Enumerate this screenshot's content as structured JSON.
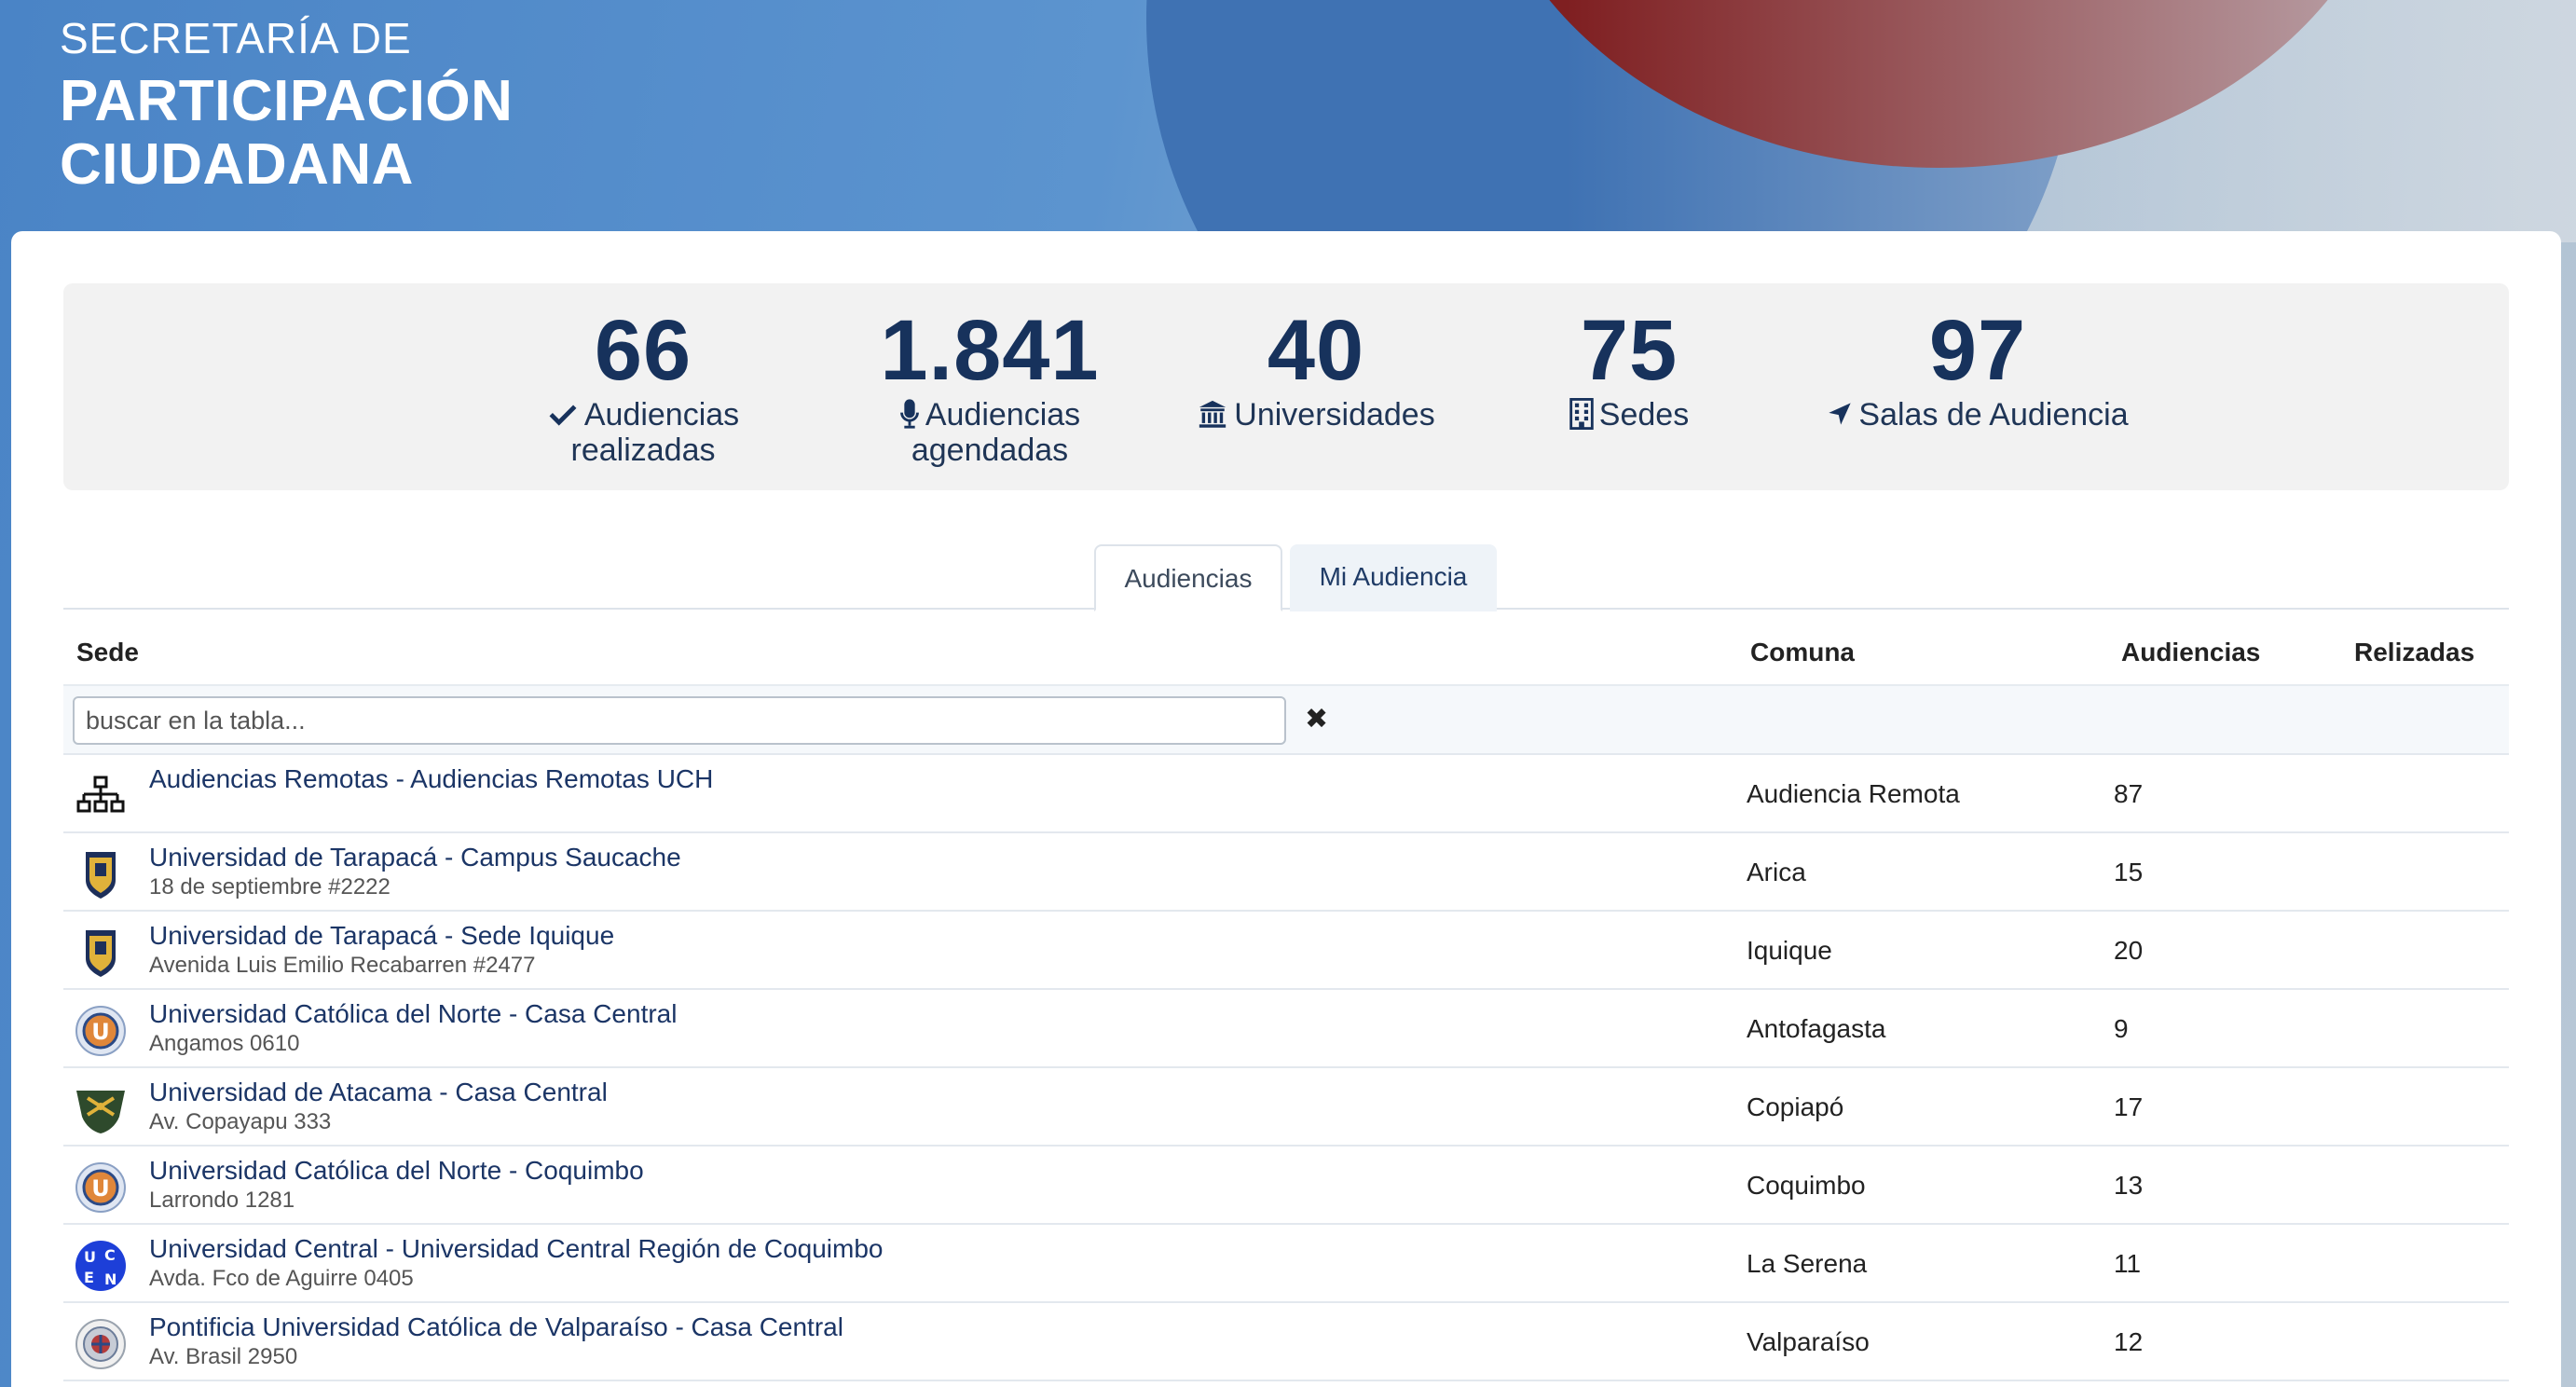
{
  "brand": {
    "line1": "SECRETARÍA DE",
    "line2": "PARTICIPACIÓN",
    "line3": "CIUDADANA"
  },
  "stats": [
    {
      "value": "66",
      "label_line1": "Audiencias",
      "label_line2": "realizadas",
      "icon": "check-icon"
    },
    {
      "value": "1.841",
      "label_line1": "Audiencias",
      "label_line2": "agendadas",
      "icon": "microphone-icon"
    },
    {
      "value": "40",
      "label_line1": "Universidades",
      "label_line2": "",
      "icon": "university-icon"
    },
    {
      "value": "75",
      "label_line1": "Sedes",
      "label_line2": "",
      "icon": "building-icon"
    },
    {
      "value": "97",
      "label_line1": "Salas de Audiencia",
      "label_line2": "",
      "icon": "location-arrow-icon"
    }
  ],
  "tabs": [
    {
      "label": "Audiencias",
      "active": true
    },
    {
      "label": "Mi Audiencia",
      "active": false
    }
  ],
  "table": {
    "headers": {
      "sede": "Sede",
      "comuna": "Comuna",
      "audiencias": "Audiencias",
      "realizadas": "Relizadas"
    },
    "search_placeholder": "buscar en la tabla...",
    "clear_icon": "✖",
    "rows": [
      {
        "name": "Audiencias Remotas - Audiencias Remotas UCH",
        "address": "",
        "comuna": "Audiencia Remota",
        "audiencias": "87",
        "logo": "network-icon"
      },
      {
        "name": "Universidad de Tarapacá - Campus Saucache",
        "address": "18 de septiembre #2222",
        "comuna": "Arica",
        "audiencias": "15",
        "logo": "tarapaca-logo"
      },
      {
        "name": "Universidad de Tarapacá - Sede Iquique",
        "address": "Avenida Luis Emilio Recabarren #2477",
        "comuna": "Iquique",
        "audiencias": "20",
        "logo": "tarapaca-logo"
      },
      {
        "name": "Universidad Católica del Norte - Casa Central",
        "address": "Angamos 0610",
        "comuna": "Antofagasta",
        "audiencias": "9",
        "logo": "ucn-logo"
      },
      {
        "name": "Universidad de Atacama - Casa Central",
        "address": "Av. Copayapu 333",
        "comuna": "Copiapó",
        "audiencias": "17",
        "logo": "atacama-logo"
      },
      {
        "name": "Universidad Católica del Norte - Coquimbo",
        "address": "Larrondo 1281",
        "comuna": "Coquimbo",
        "audiencias": "13",
        "logo": "ucn-logo"
      },
      {
        "name": "Universidad Central - Universidad Central Región de Coquimbo",
        "address": "Avda. Fco de Aguirre 0405",
        "comuna": "La Serena",
        "audiencias": "11",
        "logo": "ucen-logo"
      },
      {
        "name": "Pontificia Universidad Católica de Valparaíso - Casa Central",
        "address": "Av. Brasil 2950",
        "comuna": "Valparaíso",
        "audiencias": "12",
        "logo": "pucv-logo"
      }
    ]
  },
  "ucen_logo_letters": [
    "U",
    "C",
    "E",
    "N"
  ],
  "ucn_logo_letter": "U"
}
